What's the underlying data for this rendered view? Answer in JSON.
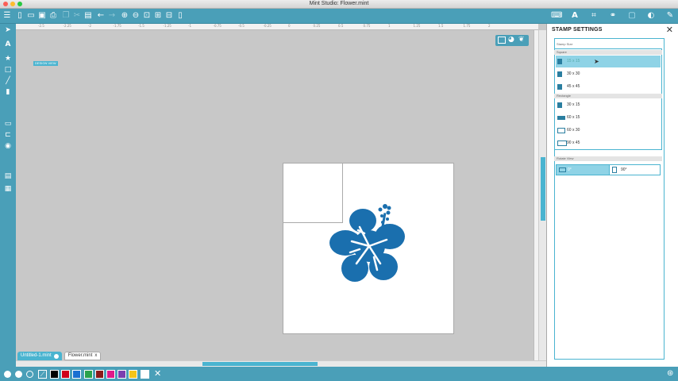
{
  "window": {
    "title": "Mint Studio: Flower.mint",
    "traffic_lights": [
      "#fc5f57",
      "#fdbc2e",
      "#28c840"
    ]
  },
  "canvas": {
    "view_label": "DESIGN VIEW",
    "ruler_ticks": [
      "-2.5",
      "-2.25",
      "-2",
      "-1.75",
      "-1.5",
      "-1.25",
      "-1",
      "-0.75",
      "-0.5",
      "-0.25",
      "0",
      "0.25",
      "0.5",
      "0.75",
      "1",
      "1.25",
      "1.5",
      "1.75",
      "2"
    ]
  },
  "tabs": [
    {
      "label": "Untitled-1.mint",
      "active": true
    },
    {
      "label": "Flower.mint",
      "active": false
    }
  ],
  "swatches": [
    "#000000",
    "#d0021b",
    "#1a6fd1",
    "#2aa24a",
    "#8b1a1a",
    "#e01a8a",
    "#7b3fb0",
    "#f5c518",
    "#ffffff"
  ],
  "panel": {
    "title": "STAMP SETTINGS",
    "stamp_size_label": "Stamp Size",
    "square_label": "Square",
    "square_options": [
      "15 x 15",
      "30 x 30",
      "45 x 45"
    ],
    "rectangle_label": "Rectangle",
    "rectangle_options": [
      "30 x 15",
      "60 x 15",
      "60 x 30",
      "90 x 45"
    ],
    "rotate_label": "Rotate View",
    "rotate_options": [
      "0°",
      "90°"
    ],
    "selected_size": "15 x 15",
    "selected_rotation": "0°"
  },
  "colors": {
    "accent": "#4a9fb8",
    "highlight": "#8fd3e6",
    "flower": "#1a6fae"
  }
}
